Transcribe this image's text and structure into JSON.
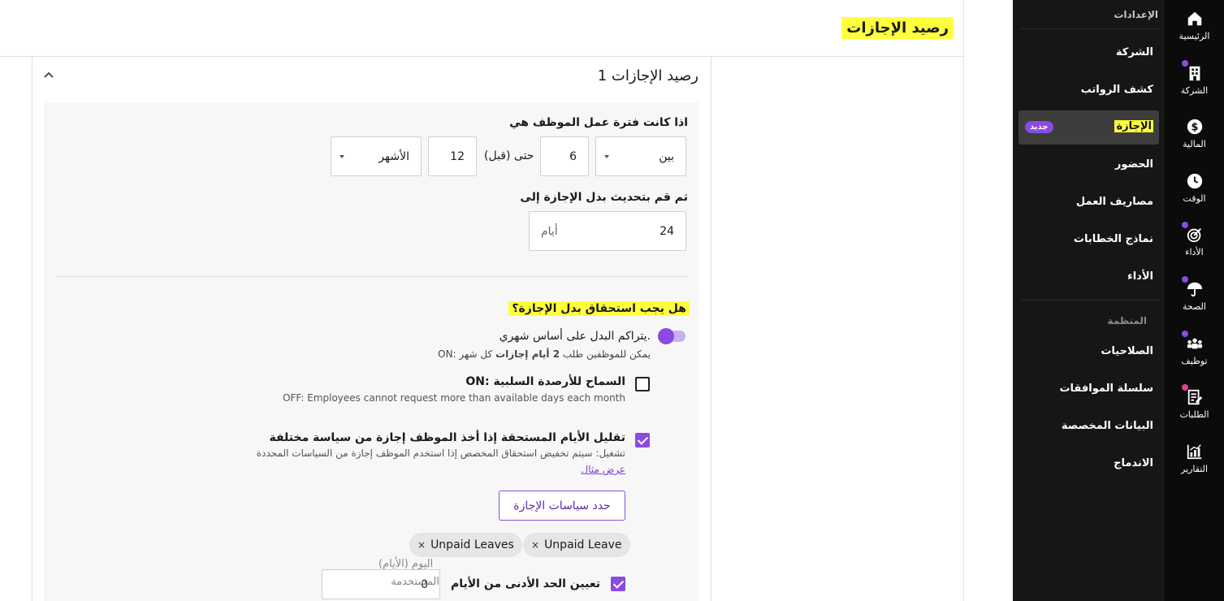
{
  "rail": {
    "items": [
      {
        "label": "الرئيسية",
        "icon": "home-icon"
      },
      {
        "label": "الشركة",
        "icon": "building-icon"
      },
      {
        "label": "المالية",
        "icon": "dollar-icon"
      },
      {
        "label": "الوقت",
        "icon": "clock-icon"
      },
      {
        "label": "الأداء",
        "icon": "target-icon"
      },
      {
        "label": "الصحة",
        "icon": "umbrella-icon"
      },
      {
        "label": "توظيف",
        "icon": "people-icon"
      },
      {
        "label": "الطلبات",
        "icon": "document-edit-icon"
      },
      {
        "label": "التقارير",
        "icon": "chart-icon"
      }
    ]
  },
  "sidebar": {
    "section1": "الإعدادات",
    "items1": [
      "الشركة",
      "كشف الرواتب",
      "الإجازة",
      "الحضور",
      "مصاريف العمل",
      "نماذج الخطابات",
      "الأداء"
    ],
    "active_badge": "جديد",
    "section2": "المنظمة",
    "items2": [
      "الصلاحيات",
      "سلسلة الموافقات",
      "البيانات المخصصة",
      "الاندماج"
    ]
  },
  "page": {
    "title": "رصيد الإجازات"
  },
  "card": {
    "title": "رصيد الإجازات 1",
    "period_label": "اذا كانت فترة عمل الموظف هي",
    "condition_select": "بين",
    "from_value": "6",
    "until_label": "حتى (قبل)",
    "to_value": "12",
    "unit_select": "الأشهر",
    "update_label": "ثم قم بتحديث بدل الإجازة إلى",
    "days_value": "24",
    "days_unit": "أيام",
    "accrual_question": "هل يجب استحقاق بدل الإجازة؟",
    "monthly_label": "يتراكم البدل على أساس شهري.",
    "monthly_desc_pre": "ON: يمكن للموظفين طلب",
    "monthly_desc_bold": "2 أيام إجازات",
    "monthly_desc_post": "كل شهر",
    "negative_label": "ON: السماح للأرصدة السلبية",
    "negative_desc": "OFF: Employees cannot request more than available days each month",
    "reduce_label": "تقليل الأيام المستحقة إذا أخذ الموظف إجازة من سياسة مختلفة",
    "reduce_desc": "تشغيل: سيتم تخفيض استحقاق المخصص إذا استخدم الموظف إجازة من السياسات المحددة",
    "example_link": "عرض مثال",
    "define_button": "حدد سياسات الإجازة",
    "chips": [
      "Unpaid Leave",
      "Unpaid Leaves"
    ],
    "chip_close": "×",
    "min_days_label": "تعيين الحد الأدنى من الأيام",
    "min_days_value": "0",
    "min_days_hint_1": "اليوم (الأيام)",
    "min_days_hint_2": "المستخدمة"
  }
}
